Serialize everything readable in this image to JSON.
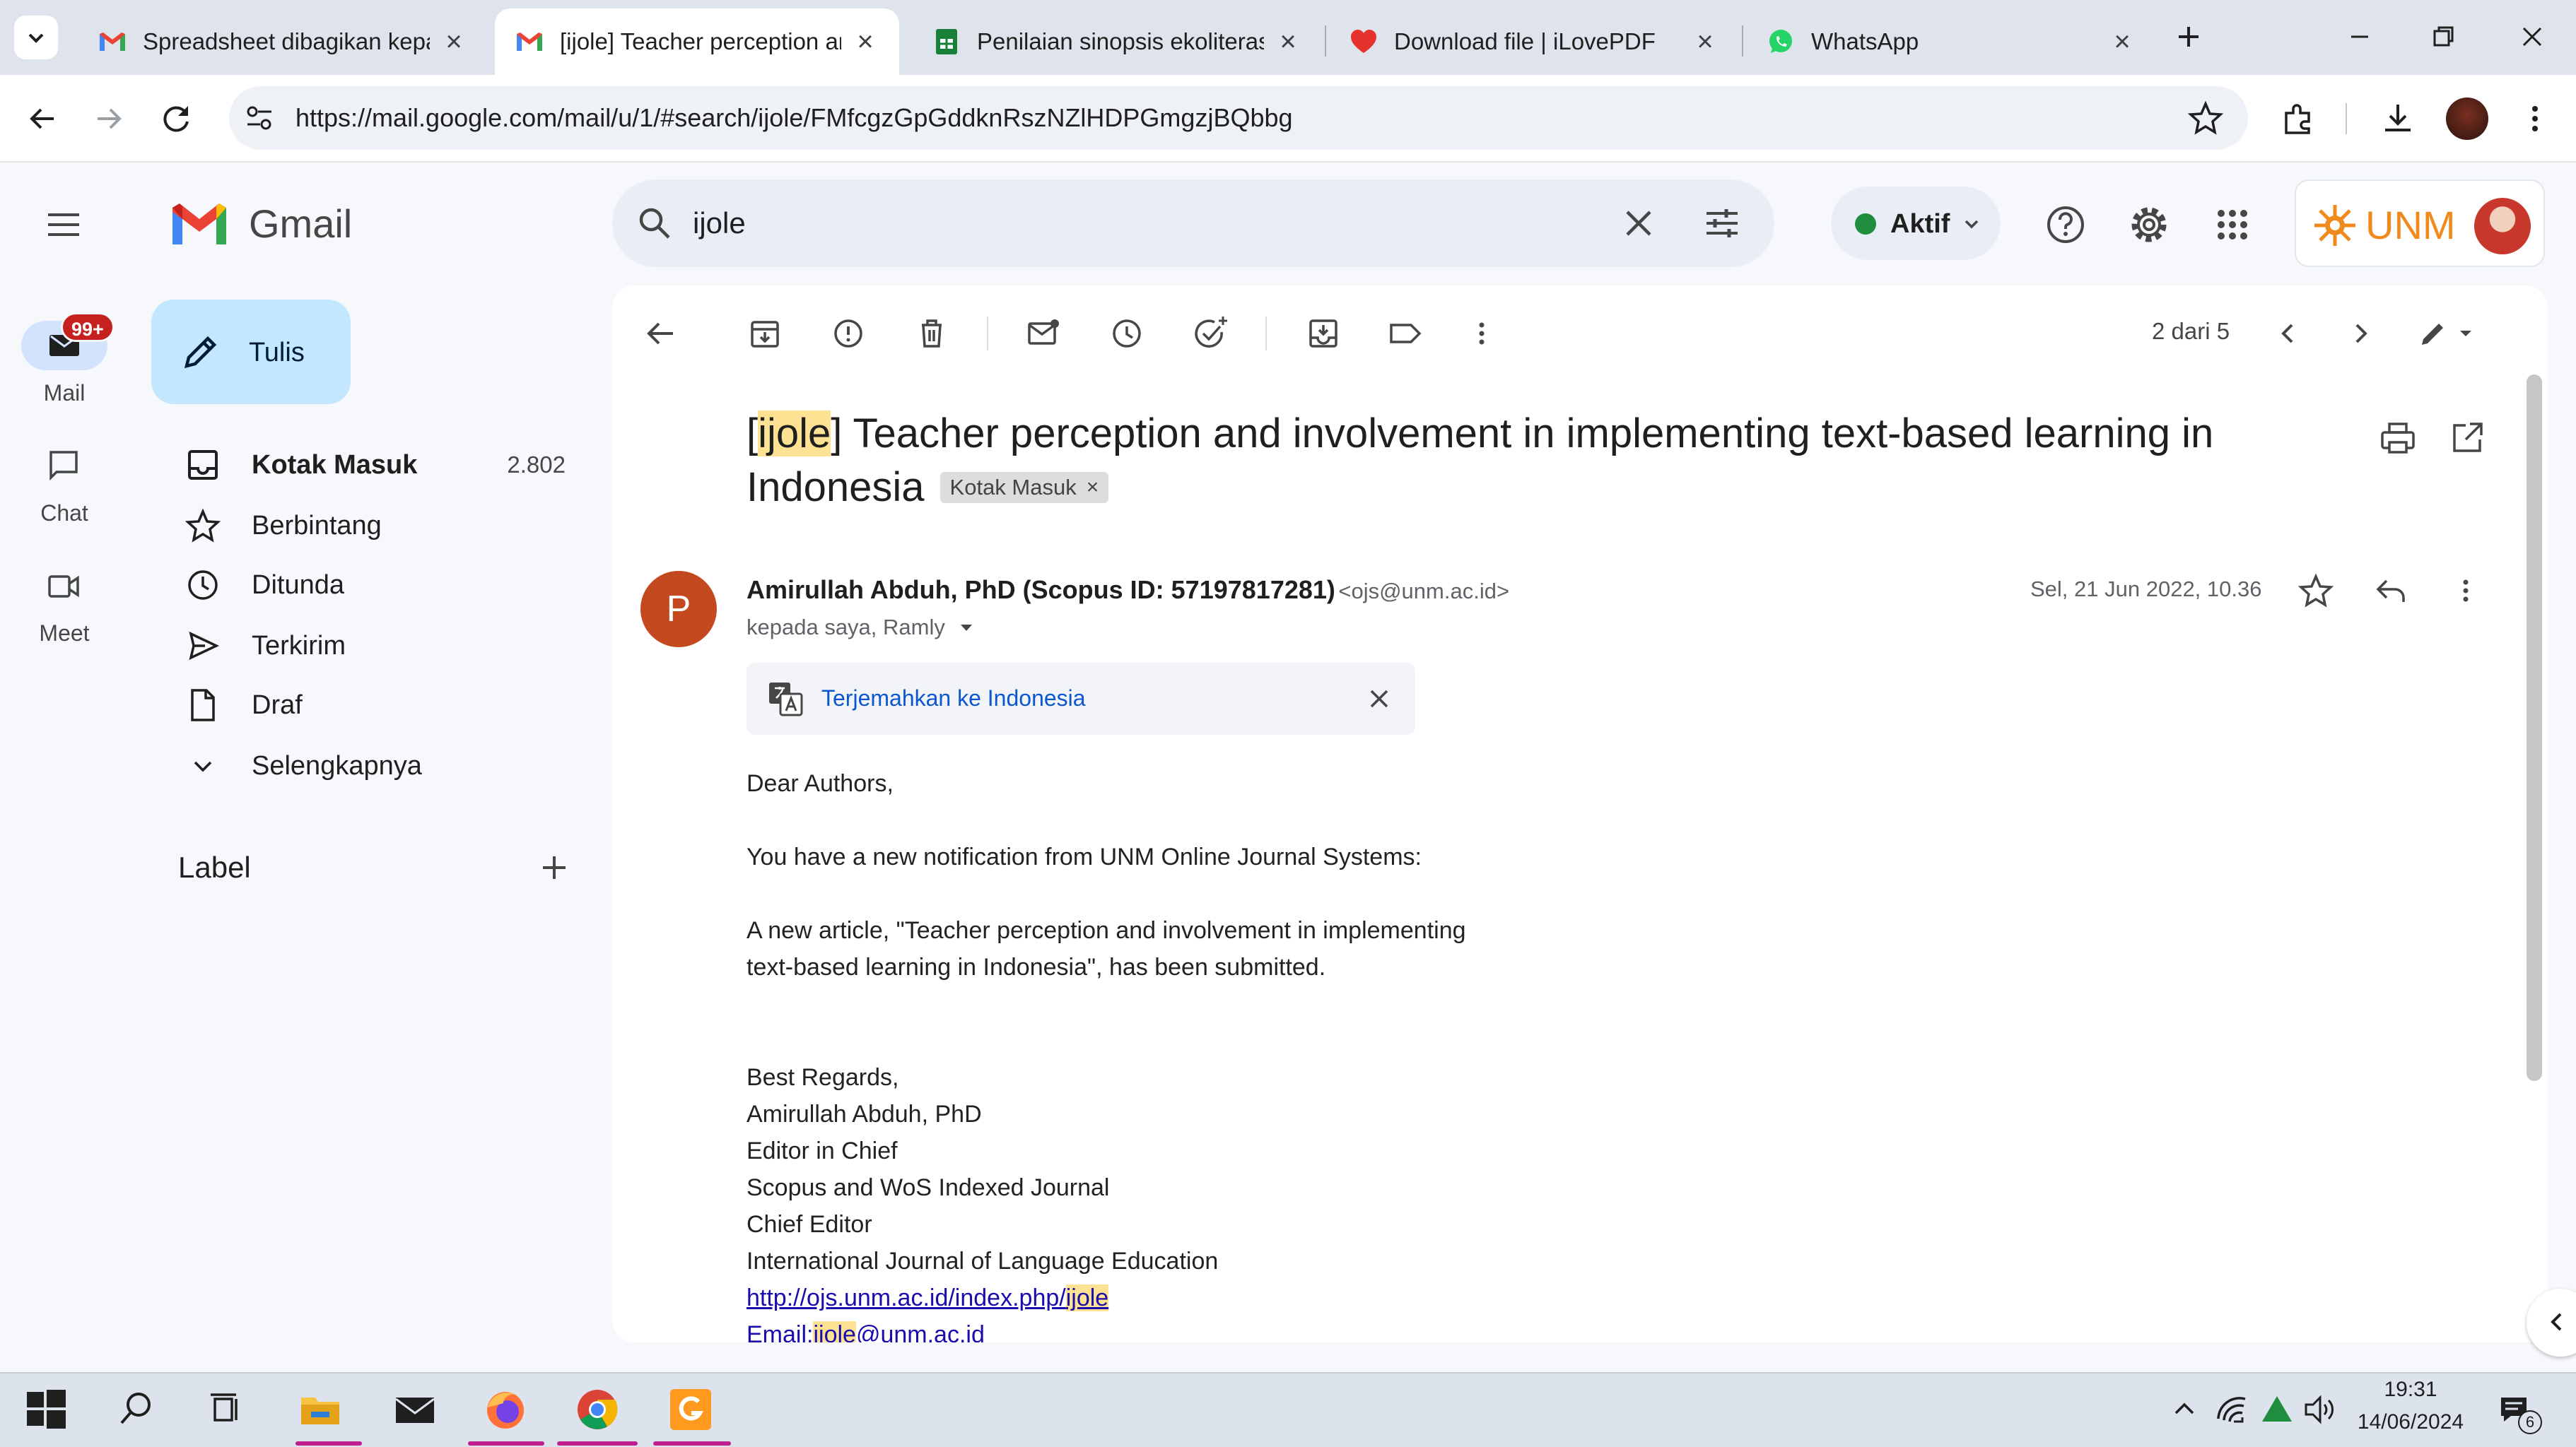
{
  "browser": {
    "tabs": [
      {
        "title": "Spreadsheet dibagikan kepada",
        "active": false
      },
      {
        "title": "[ijole] Teacher perception an",
        "active": true
      },
      {
        "title": "Penilaian sinopsis ekoliterasi",
        "active": false
      },
      {
        "title": "Download file | iLovePDF",
        "active": false
      },
      {
        "title": "WhatsApp",
        "active": false
      }
    ],
    "url": "https://mail.google.com/mail/u/1/#search/ijole/FMfcgzGpGddknRszNZlHDPGmgzjBQbbg"
  },
  "gmail": {
    "logo_text": "Gmail",
    "search_value": "ijole",
    "status_label": "Aktif",
    "account_brand": "UNM",
    "rail": {
      "mail_label": "Mail",
      "mail_badge": "99+",
      "chat_label": "Chat",
      "meet_label": "Meet"
    },
    "compose_label": "Tulis",
    "nav": [
      {
        "label": "Kotak Masuk",
        "count": "2.802",
        "icon": "inbox-icon",
        "bold": true
      },
      {
        "label": "Berbintang",
        "count": "",
        "icon": "star-icon"
      },
      {
        "label": "Ditunda",
        "count": "",
        "icon": "clock-icon"
      },
      {
        "label": "Terkirim",
        "count": "",
        "icon": "send-icon"
      },
      {
        "label": "Draf",
        "count": "",
        "icon": "draft-icon"
      },
      {
        "label": "Selengkapnya",
        "count": "",
        "icon": "chevron-down-icon"
      }
    ],
    "labels_heading": "Label",
    "toolbar": {
      "pagination": "2 dari 5"
    },
    "message": {
      "subject_tag": "ijole",
      "subject_rest": "] Teacher perception and involvement in implementing text-based learning in",
      "subject_line2": "Indonesia",
      "subject_bracket_open": "[",
      "label_chip": "Kotak Masuk",
      "avatar_letter": "P",
      "avatar_color": "#c5491f",
      "sender_name": "Amirullah Abduh, PhD (Scopus ID: 57197817281)",
      "sender_email": "<ojs@unm.ac.id>",
      "recipients": "kepada saya, Ramly",
      "date": "Sel, 21 Jun 2022, 10.36",
      "translate_label": "Terjemahkan ke Indonesia",
      "body": {
        "greeting": "Dear Authors,",
        "line1": "You have a new notification from UNM Online Journal Systems:",
        "line2": "A new article, \"Teacher perception and involvement in implementing",
        "line3": "text-based learning in Indonesia\", has been submitted.",
        "closing": "Best Regards,",
        "sig1": "Amirullah Abduh, PhD",
        "sig2": "Editor in Chief",
        "sig3": "Scopus and WoS Indexed Journal",
        "sig4": "Chief Editor",
        "sig5": "International Journal of Language Education",
        "link_prefix": "http://ojs.unm.ac.id/index.php/",
        "link_tag": "ijole",
        "email_prefix": "Email:",
        "email_tag": "ijole",
        "email_suffix": "@unm.ac.id"
      }
    }
  },
  "taskbar": {
    "time": "19:31",
    "date": "14/06/2024",
    "notif_count": "6"
  },
  "colors": {
    "accent": "#0b57d0",
    "compose_bg": "#c2e7ff",
    "highlight": "#fde293",
    "gmail_red": "#ea4335"
  }
}
